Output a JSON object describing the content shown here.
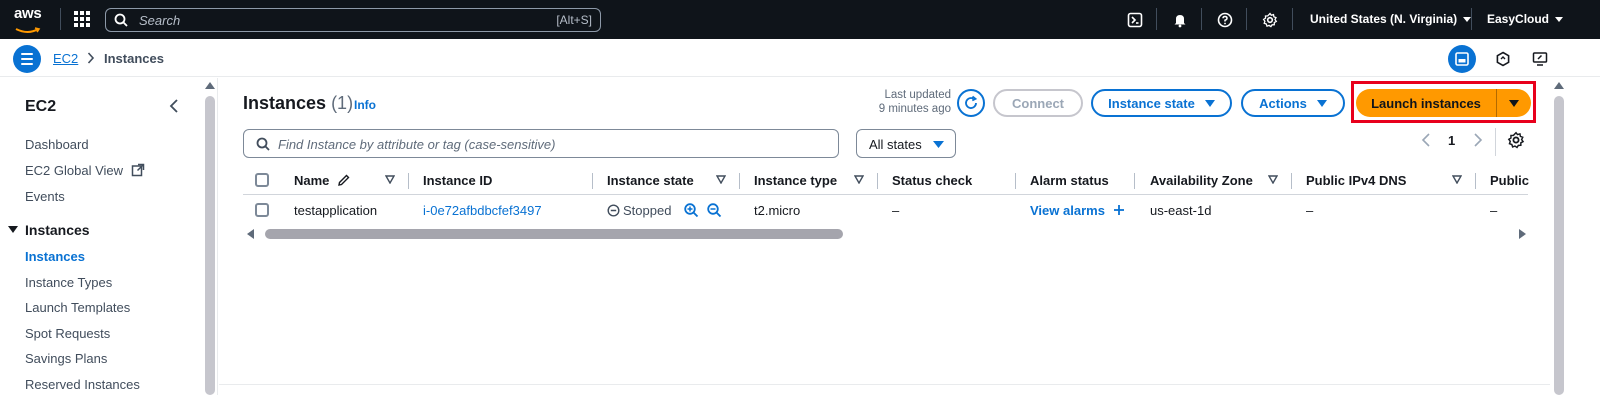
{
  "topnav": {
    "logo_text": "aws",
    "search_placeholder": "Search",
    "search_shortcut": "[Alt+S]",
    "region": "United States (N. Virginia)",
    "account": "EasyCloud"
  },
  "breadcrumb": {
    "parent": "EC2",
    "current": "Instances"
  },
  "sidebar": {
    "title": "EC2",
    "top_items": [
      "Dashboard",
      "EC2 Global View",
      "Events"
    ],
    "section": "Instances",
    "section_items": [
      "Instances",
      "Instance Types",
      "Launch Templates",
      "Spot Requests",
      "Savings Plans",
      "Reserved Instances"
    ],
    "active_item": "Instances"
  },
  "main": {
    "title": "Instances",
    "count": "(1)",
    "info": "Info",
    "last_updated_line1": "Last updated",
    "last_updated_line2": "9 minutes ago",
    "connect_label": "Connect",
    "instance_state_label": "Instance state",
    "actions_label": "Actions",
    "launch_label": "Launch instances",
    "filter_placeholder": "Find Instance by attribute or tag (case-sensitive)",
    "states_filter": "All states",
    "page_number": "1"
  },
  "table": {
    "columns": [
      "Name",
      "Instance ID",
      "Instance state",
      "Instance type",
      "Status check",
      "Alarm status",
      "Availability Zone",
      "Public IPv4 DNS",
      "Public"
    ],
    "rows": [
      {
        "name": "testapplication",
        "instance_id": "i-0e72afbdbcfef3497",
        "state": "Stopped",
        "type": "t2.micro",
        "status_check": "–",
        "alarm_status": "View alarms",
        "az": "us-east-1d",
        "public_dns": "–",
        "public": "–"
      }
    ]
  },
  "colors": {
    "accent": "#0972d3",
    "launch": "#ff9900",
    "highlight": "#e8001c",
    "topnav_bg": "#0f141a"
  }
}
